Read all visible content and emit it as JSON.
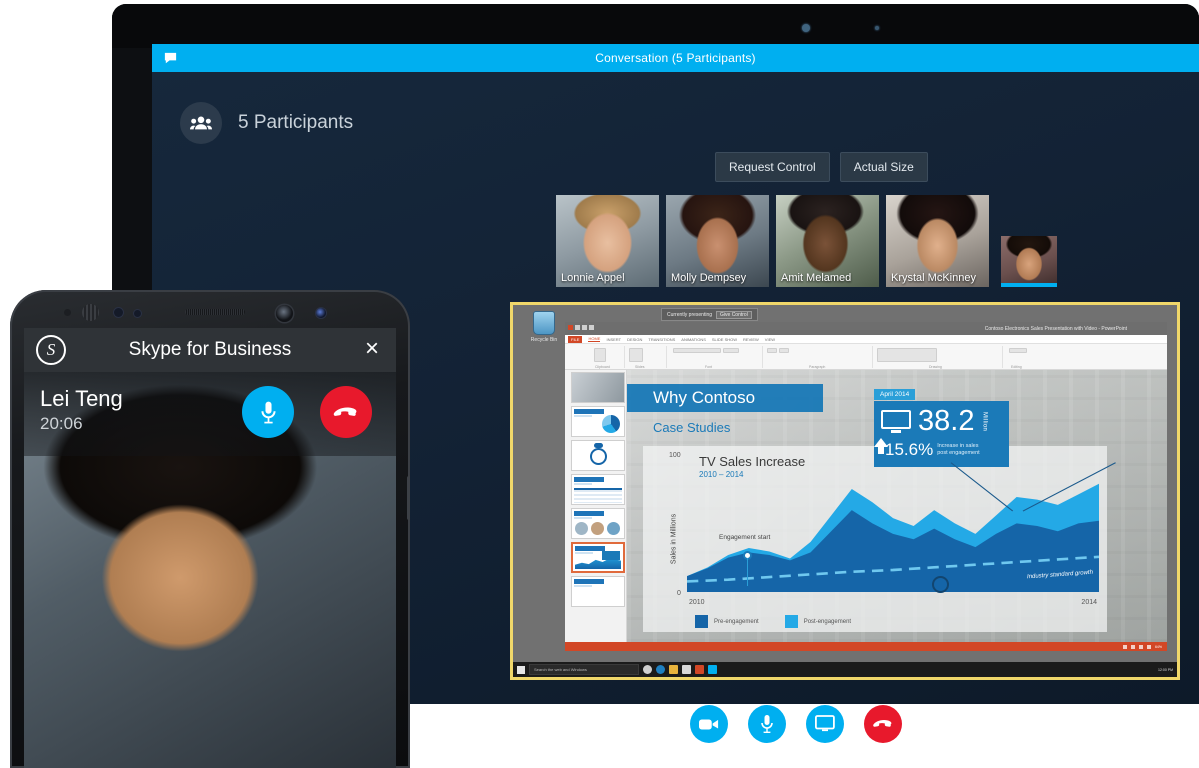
{
  "laptop": {
    "titlebar": {
      "text": "Conversation (5 Participants)",
      "icon": "chat-bubble-icon",
      "color": "#00aff0"
    },
    "participants": {
      "count_label": "5 Participants",
      "icon": "people-icon"
    },
    "buttons": [
      {
        "label": "Request Control",
        "name": "request-control-button"
      },
      {
        "label": "Actual Size",
        "name": "actual-size-button"
      }
    ],
    "thumbnails": [
      {
        "name": "Lonnie Appel"
      },
      {
        "name": "Molly Dempsey"
      },
      {
        "name": "Amit Melamed"
      },
      {
        "name": "Krystal McKinney"
      },
      {
        "name": "",
        "active_speaker": true
      }
    ],
    "call_controls": [
      {
        "name": "video-camera-button",
        "icon": "video-camera-icon",
        "color": "#00aff0"
      },
      {
        "name": "microphone-button",
        "icon": "microphone-icon",
        "color": "#00aff0"
      },
      {
        "name": "share-screen-button",
        "icon": "monitor-icon",
        "color": "#00aff0"
      },
      {
        "name": "end-call-button",
        "icon": "hangup-phone-icon",
        "color": "#e8192c"
      }
    ]
  },
  "share": {
    "border_color": "#f0d76a",
    "desktop": {
      "recycle_bin_label": "Recycle Bin"
    },
    "presenting_bar": {
      "status": "Currently presenting",
      "give_control": "Give Control"
    },
    "powerpoint": {
      "title": "Contoso Electronics Sales Presentation with Video  -  PowerPoint",
      "tabs": [
        "FILE",
        "HOME",
        "INSERT",
        "DESIGN",
        "TRANSITIONS",
        "ANIMATIONS",
        "SLIDE SHOW",
        "REVIEW",
        "VIEW"
      ],
      "ribbon_groups": [
        "Clipboard",
        "Slides",
        "Font",
        "Paragraph",
        "Drawing",
        "Editing"
      ],
      "slide_thumbnails": [
        {
          "number": "1"
        },
        {
          "number": "2"
        },
        {
          "number": "3"
        },
        {
          "number": "4"
        },
        {
          "number": "5"
        },
        {
          "number": "6",
          "selected": true
        },
        {
          "number": "7"
        }
      ],
      "zoom_label": "64%"
    },
    "slide": {
      "title": "Why Contoso",
      "subtitle": "Case Studies",
      "callout": {
        "tab_label": "April 2014",
        "value": "38.2",
        "unit": "Million",
        "percent": "15.6%",
        "percent_caption_line1": "Increase in sales",
        "percent_caption_line2": "post engagement",
        "icon": "monitor-icon",
        "arrow_icon": "up-arrow-icon"
      }
    },
    "taskbar": {
      "search_placeholder": "Search the web and Windows",
      "icons": [
        "windows-logo-icon",
        "cortana-icon",
        "edge-icon",
        "file-explorer-icon",
        "store-icon",
        "powerpoint-icon",
        "skype-icon"
      ],
      "clock": "12:00 PM"
    }
  },
  "chart_data": {
    "type": "area",
    "title": "TV Sales Increase",
    "subtitle": "2010 – 2014",
    "ylabel": "Sales in Millions",
    "xlabel": "",
    "ylim": [
      0,
      100
    ],
    "ytick_labels": [
      "0",
      "100"
    ],
    "xtick_labels": [
      "2010",
      "2014"
    ],
    "xlim": [
      "2010",
      "2014"
    ],
    "grid": false,
    "legend_position": "bottom-left",
    "legend": [
      "Pre-engagement",
      "Post-engagement"
    ],
    "annotations": [
      {
        "text": "Engagement start",
        "x": "2010.6",
        "y": 30
      },
      {
        "text": "Industry standard growth",
        "x": "2013.5",
        "y": 18
      },
      {
        "text": "April 2014",
        "x": "2013.2",
        "y": 52
      }
    ],
    "colors": {
      "pre_engagement": "#1565a8",
      "post_engagement": "#24a9e6",
      "trend_line": "#4fb8e8"
    },
    "series": [
      {
        "name": "Pre-engagement",
        "values": [
          12,
          18,
          26,
          30,
          28,
          24,
          30,
          46,
          62,
          52,
          44,
          40,
          48,
          40,
          34,
          44,
          52,
          50,
          46,
          52,
          54
        ]
      },
      {
        "name": "Post-engagement",
        "values": [
          12,
          19,
          28,
          33,
          31,
          27,
          38,
          58,
          78,
          68,
          56,
          50,
          62,
          52,
          44,
          58,
          70,
          68,
          64,
          74,
          82
        ]
      },
      {
        "name": "Industry standard growth",
        "values": [
          8,
          9,
          10,
          11,
          12,
          12,
          13,
          14,
          15,
          16,
          16,
          17,
          18,
          18,
          19,
          20,
          21,
          22,
          23,
          24,
          25
        ]
      }
    ],
    "x": [
      "2010",
      "2010.2",
      "2010.4",
      "2010.6",
      "2010.8",
      "2011",
      "2011.2",
      "2011.4",
      "2011.6",
      "2011.8",
      "2012",
      "2012.2",
      "2012.4",
      "2012.6",
      "2012.8",
      "2013",
      "2013.2",
      "2013.4",
      "2013.6",
      "2013.8",
      "2014"
    ]
  },
  "phone": {
    "header": {
      "title": "Skype for Business",
      "logo": "skype-logo-icon",
      "close": "×"
    },
    "call": {
      "caller": "Lei Teng",
      "duration": "20:06"
    },
    "actions": [
      {
        "name": "mute-button",
        "icon": "microphone-icon",
        "color": "#00aff0"
      },
      {
        "name": "end-call-button",
        "icon": "hangup-phone-icon",
        "color": "#e8192c"
      }
    ]
  }
}
